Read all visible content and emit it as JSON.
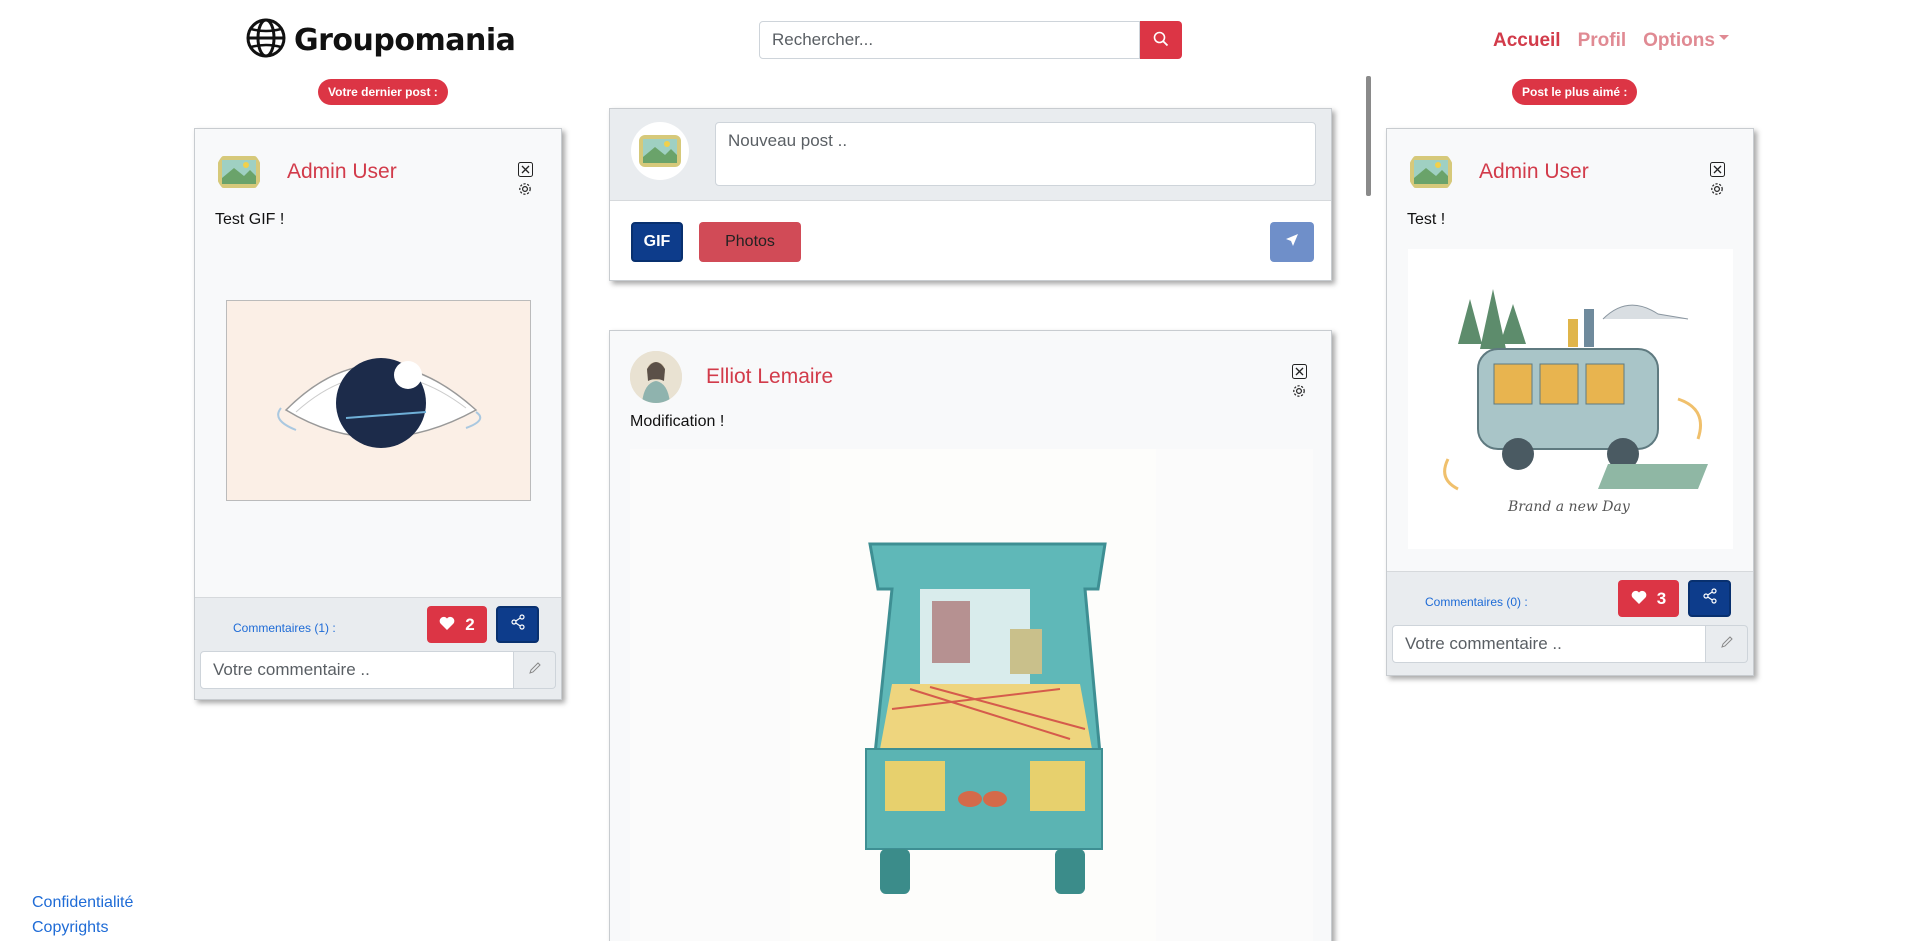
{
  "header": {
    "brand": "Groupomania",
    "search_placeholder": "Rechercher...",
    "nav": {
      "home": "Accueil",
      "profile": "Profil",
      "options": "Options"
    }
  },
  "left_panel": {
    "pill": "Votre dernier post :",
    "post": {
      "author": "Admin User",
      "text": "Test GIF !",
      "comments_label": "Commentaires (1) :",
      "likes": "2",
      "comment_placeholder": "Votre commentaire .."
    }
  },
  "composer": {
    "placeholder": "Nouveau post ..",
    "gif_label": "GIF",
    "photos_label": "Photos"
  },
  "feed": {
    "post": {
      "author": "Elliot Lemaire",
      "text": "Modification !"
    }
  },
  "right_panel": {
    "pill": "Post le plus aimé :",
    "post": {
      "author": "Admin User",
      "text": "Test !",
      "image_caption": "Brand a new Day",
      "comments_label": "Commentaires (0) :",
      "likes": "3",
      "comment_placeholder": "Votre commentaire .."
    }
  },
  "footer": {
    "privacy": "Confidentialité",
    "copyrights": "Copyrights"
  },
  "colors": {
    "accent_red": "#dc3545",
    "navy": "#0d3c8b",
    "link_blue": "#1e6bd6",
    "username_red": "#d23b4a"
  }
}
